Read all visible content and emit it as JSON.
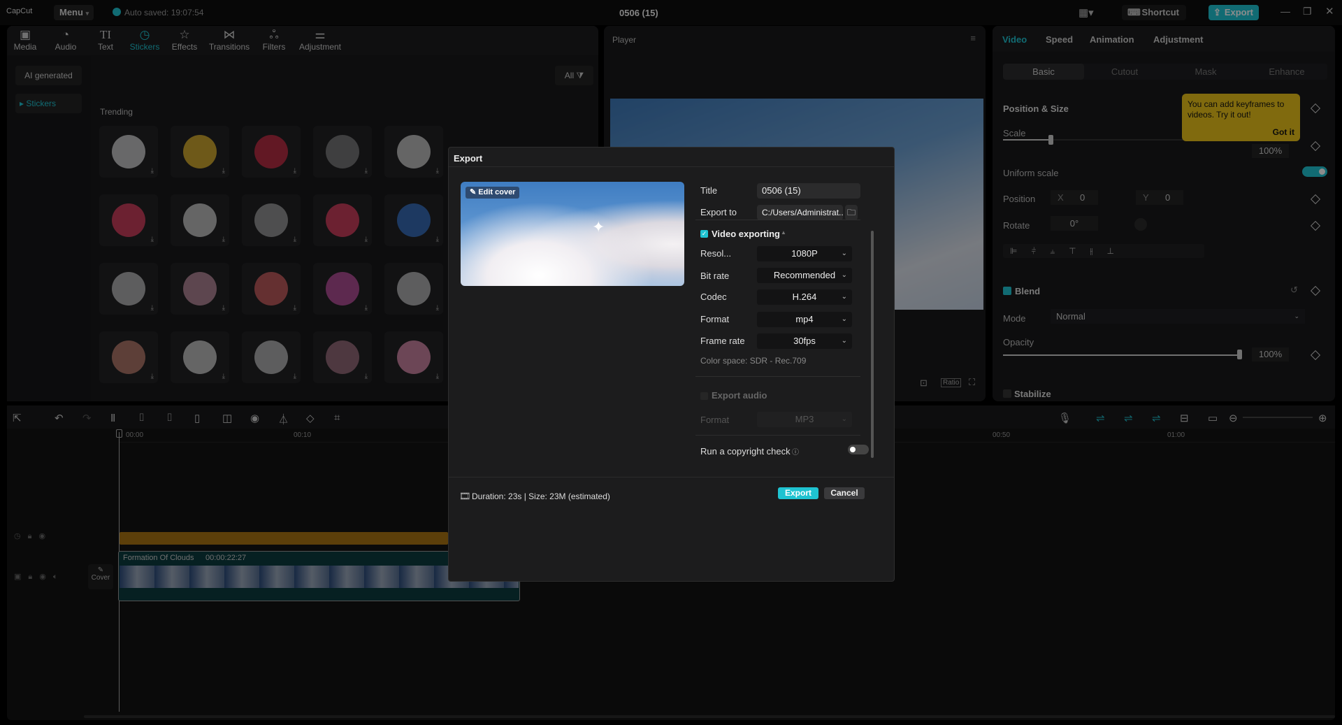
{
  "app": {
    "logo": "CapCut",
    "menu": "Menu",
    "autosave": "Auto saved: 19:07:54",
    "project_title": "0506 (15)",
    "shortcut": "Shortcut",
    "export": "Export"
  },
  "media_tabs": [
    {
      "label": "Media",
      "icon": "media-icon"
    },
    {
      "label": "Audio",
      "icon": "audio-icon"
    },
    {
      "label": "Text",
      "icon": "text-icon"
    },
    {
      "label": "Stickers",
      "icon": "stickers-icon",
      "active": true
    },
    {
      "label": "Effects",
      "icon": "effects-icon"
    },
    {
      "label": "Transitions",
      "icon": "transitions-icon"
    },
    {
      "label": "Filters",
      "icon": "filters-icon"
    },
    {
      "label": "Adjustment",
      "icon": "adjustment-icon"
    }
  ],
  "sticker_sidebar": {
    "ai_generated": "AI generated",
    "stickers": "Stickers"
  },
  "stickers": {
    "filter": "All",
    "section": "Trending"
  },
  "player": {
    "title": "Player",
    "ratio": "Ratio"
  },
  "inspector": {
    "tabs": [
      "Video",
      "Speed",
      "Animation",
      "Adjustment"
    ],
    "subtabs": [
      "Basic",
      "Cutout",
      "Mask",
      "Enhance"
    ],
    "position_size": "Position & Size",
    "scale": "Scale",
    "scale_value": "100%",
    "scale_level": 0.2,
    "uniform_scale": "Uniform scale",
    "position": "Position",
    "x_label": "X",
    "x": "0",
    "y_label": "Y",
    "y": "0",
    "rotate": "Rotate",
    "rotate_value": "0°",
    "blend": "Blend",
    "mode": "Mode",
    "mode_value": "Normal",
    "opacity": "Opacity",
    "opacity_value": "100%",
    "opacity_level": 1.0,
    "stabilize": "Stabilize",
    "tooltip": {
      "text": "You can add keyframes to videos. Try it out!",
      "button": "Got it"
    }
  },
  "timeline": {
    "ticks": [
      "00:00",
      "00:10",
      "00:50",
      "01:00"
    ],
    "clip_name": "Formation Of Clouds",
    "clip_duration": "00:00:22:27",
    "cover": "Cover"
  },
  "export_dialog": {
    "title": "Export",
    "edit_cover": "Edit cover",
    "title_label": "Title",
    "title_value": "0506 (15)",
    "export_to_label": "Export to",
    "export_to_value": "C:/Users/Administrat...",
    "video_exporting": "Video exporting",
    "fields": [
      {
        "label": "Resol...",
        "value": "1080P"
      },
      {
        "label": "Bit rate",
        "value": "Recommended"
      },
      {
        "label": "Codec",
        "value": "H.264"
      },
      {
        "label": "Format",
        "value": "mp4"
      },
      {
        "label": "Frame rate",
        "value": "30fps"
      }
    ],
    "color_space": "Color space: SDR - Rec.709",
    "export_audio": "Export audio",
    "audio_format_label": "Format",
    "audio_format_value": "MP3",
    "copyright": "Run a copyright check",
    "summary": "Duration: 23s | Size: 23M (estimated)",
    "export_button": "Export",
    "cancel_button": "Cancel"
  },
  "colors": {
    "accent": "#1fc3d1",
    "tooltip": "#e8c11a",
    "track": "#a87312"
  }
}
